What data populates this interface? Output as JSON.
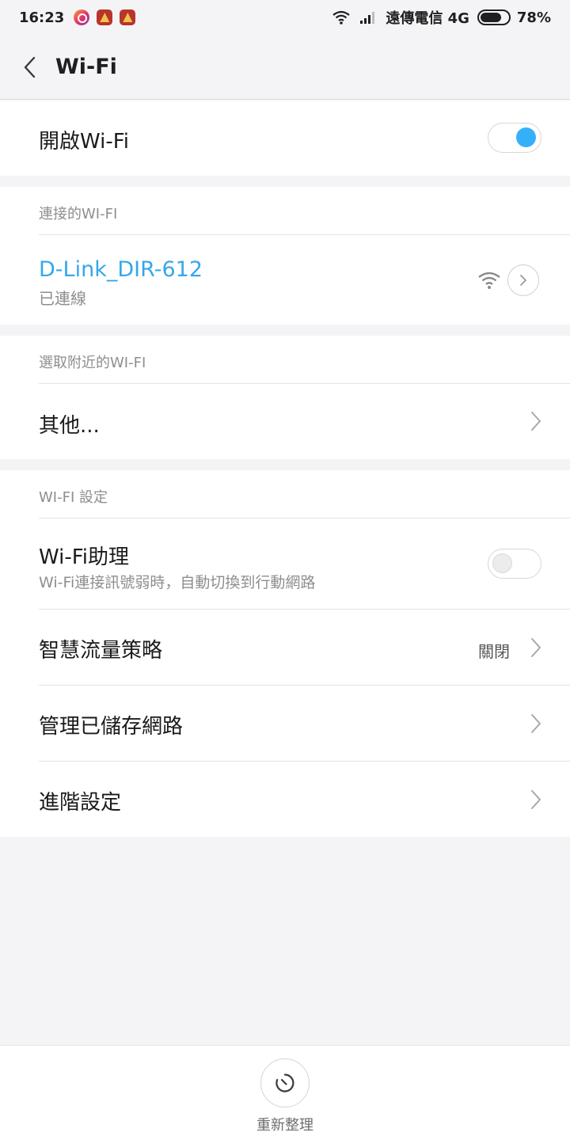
{
  "status_bar": {
    "time": "16:23",
    "carrier": "遠傳電信 4G",
    "battery": "78%",
    "battery_level": 0.78
  },
  "header": {
    "title": "Wi-Fi"
  },
  "wifi_toggle": {
    "label": "開啟Wi-Fi",
    "state": "on"
  },
  "connected": {
    "section_label": "連接的WI-FI",
    "network_name": "D-Link_DIR-612",
    "status": "已連線"
  },
  "nearby": {
    "section_label": "選取附近的WI-FI",
    "other_label": "其他..."
  },
  "settings": {
    "section_label": "WI-FI 設定",
    "assistant_title": "Wi-Fi助理",
    "assistant_subtitle": "Wi-Fi連接訊號弱時，自動切換到行動網路",
    "assistant_state": "off",
    "smart_traffic_label": "智慧流量策略",
    "smart_traffic_value": "關閉",
    "manage_saved_label": "管理已儲存網路",
    "advanced_label": "進階設定"
  },
  "bottom": {
    "refresh_label": "重新整理"
  },
  "colors": {
    "accent": "#35b0f8",
    "background": "#f4f4f6",
    "card": "#ffffff"
  }
}
